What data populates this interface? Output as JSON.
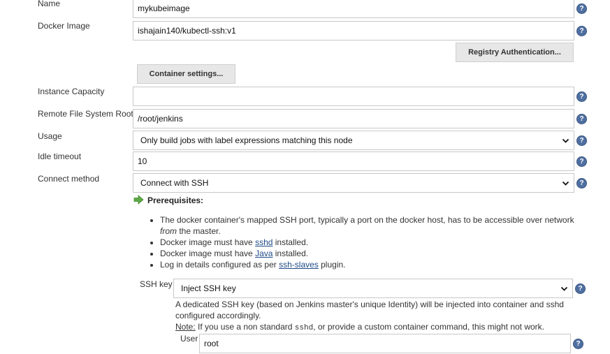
{
  "form": {
    "name": {
      "label": "Name",
      "value": "mykubeimage"
    },
    "docker_image": {
      "label": "Docker Image",
      "value": "ishajain140/kubectl-ssh:v1"
    },
    "registry_auth_button": "Registry Authentication...",
    "container_settings_button": "Container settings...",
    "instance_capacity": {
      "label": "Instance Capacity",
      "value": ""
    },
    "remote_fs_root": {
      "label": "Remote File System Root",
      "value": "/root/jenkins"
    },
    "usage": {
      "label": "Usage",
      "value": "Only build jobs with label expressions matching this node"
    },
    "idle_timeout": {
      "label": "Idle timeout",
      "value": "10"
    },
    "connect_method": {
      "label": "Connect method",
      "value": "Connect with SSH"
    }
  },
  "prerequisites": {
    "title": "Prerequisites:",
    "items": [
      {
        "text_before": "The docker container's mapped SSH port, typically a port on the docker host, has to be accessible over network ",
        "emph": "from",
        "text_after": " the master."
      },
      {
        "text_before": "Docker image must have ",
        "link": "sshd",
        "text_after": " installed."
      },
      {
        "text_before": "Docker image must have ",
        "link": "Java",
        "text_after": " installed."
      },
      {
        "text_before": "Log in details configured as per ",
        "link": "ssh-slaves",
        "text_after": " plugin."
      }
    ]
  },
  "ssh": {
    "key_label": "SSH key",
    "key_value": "Inject SSH key",
    "description": "A dedicated SSH key (based on Jenkins master's unique Identity) will be injected into container and sshd configured accordingly.",
    "note_label": "Note:",
    "note_text_before": " If you use a non standard ",
    "note_code": "sshd",
    "note_text_after": ", or provide a custom container command, this might not work.",
    "user_label": "User",
    "user_value": "root"
  },
  "colors": {
    "help_icon": "#4f6fa1",
    "link": "#204a87",
    "arrow": "#5ea846"
  },
  "icons": {
    "help": "help-icon",
    "chevron": "chevron-down-icon",
    "arrow": "green-arrow-right-icon"
  }
}
